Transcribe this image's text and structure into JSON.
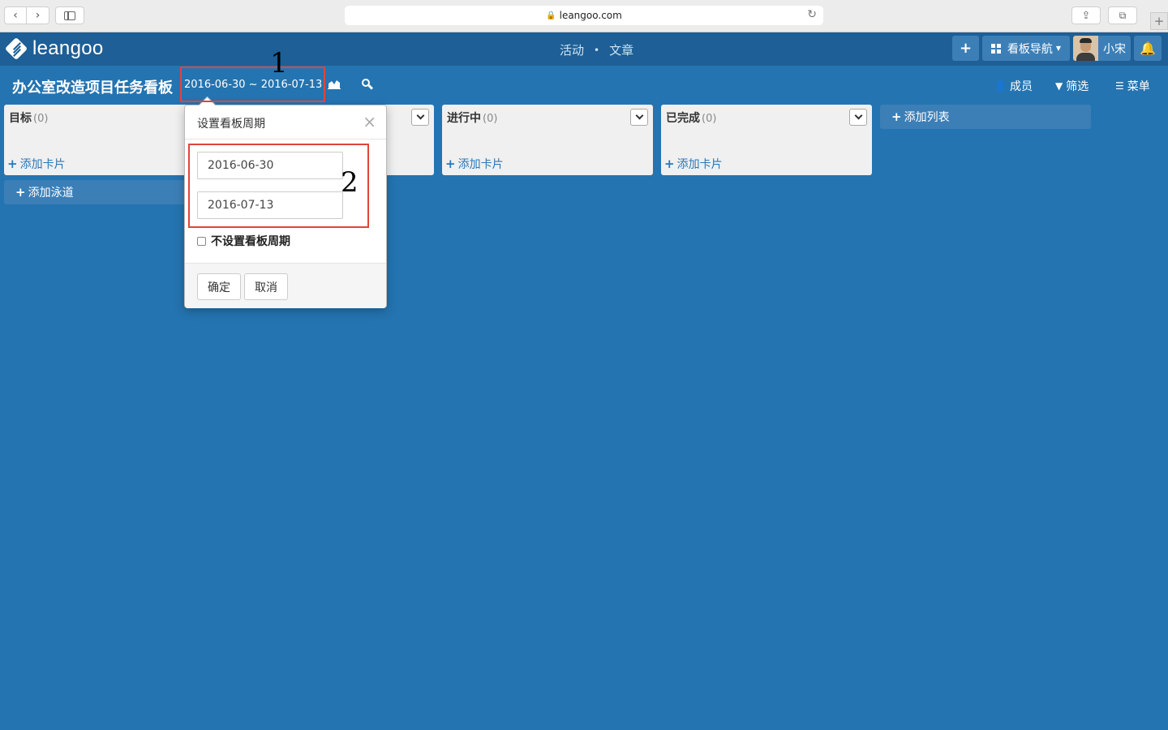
{
  "browser": {
    "url": "leangoo.com",
    "back_glyph": "‹",
    "forward_glyph": "›",
    "lock_glyph": "🔒",
    "reload_glyph": "↻",
    "share_glyph": "⇪",
    "tabs_glyph": "⧉",
    "newtab_glyph": "+"
  },
  "header": {
    "logo_text": "leangoo",
    "center_links": [
      "活动",
      "文章"
    ],
    "center_separator": "•",
    "add_glyph": "+",
    "board_nav_label": "看板导航",
    "caret_glyph": "▼",
    "user_name": "小宋",
    "bell_glyph": "🔔"
  },
  "board": {
    "title": "办公室改造项目任务看板",
    "date_range": "2016-06-30 ~ 2016-07-13",
    "members_label": "成员",
    "filter_label": "筛选",
    "menu_label": "菜单",
    "members_glyph": "👤",
    "filter_glyph": "▼",
    "menu_glyph": "☰"
  },
  "columns": [
    {
      "name": "目标",
      "count": "(0)",
      "add_label": "添加卡片"
    },
    {
      "name": "",
      "count": "",
      "add_label": ""
    },
    {
      "name": "进行中",
      "count": "(0)",
      "add_label": "添加卡片"
    },
    {
      "name": "已完成",
      "count": "(0)",
      "add_label": "添加卡片"
    }
  ],
  "add_lane_label": "添加泳道",
  "add_list_label": "添加列表",
  "plus_glyph": "+",
  "popover": {
    "title": "设置看板周期",
    "close_glyph": "×",
    "start_date": "2016-06-30",
    "end_date": "2016-07-13",
    "no_period_label": "不设置看板周期",
    "confirm_label": "确定",
    "cancel_label": "取消"
  },
  "annotations": {
    "label_1": "1",
    "label_2": "2",
    "color": "#e0453a"
  },
  "colors": {
    "board_bg": "#2474b1",
    "header_bg": "#1d5f96",
    "button_bg": "#3c7fb7",
    "link_blue": "#2a78b8"
  }
}
